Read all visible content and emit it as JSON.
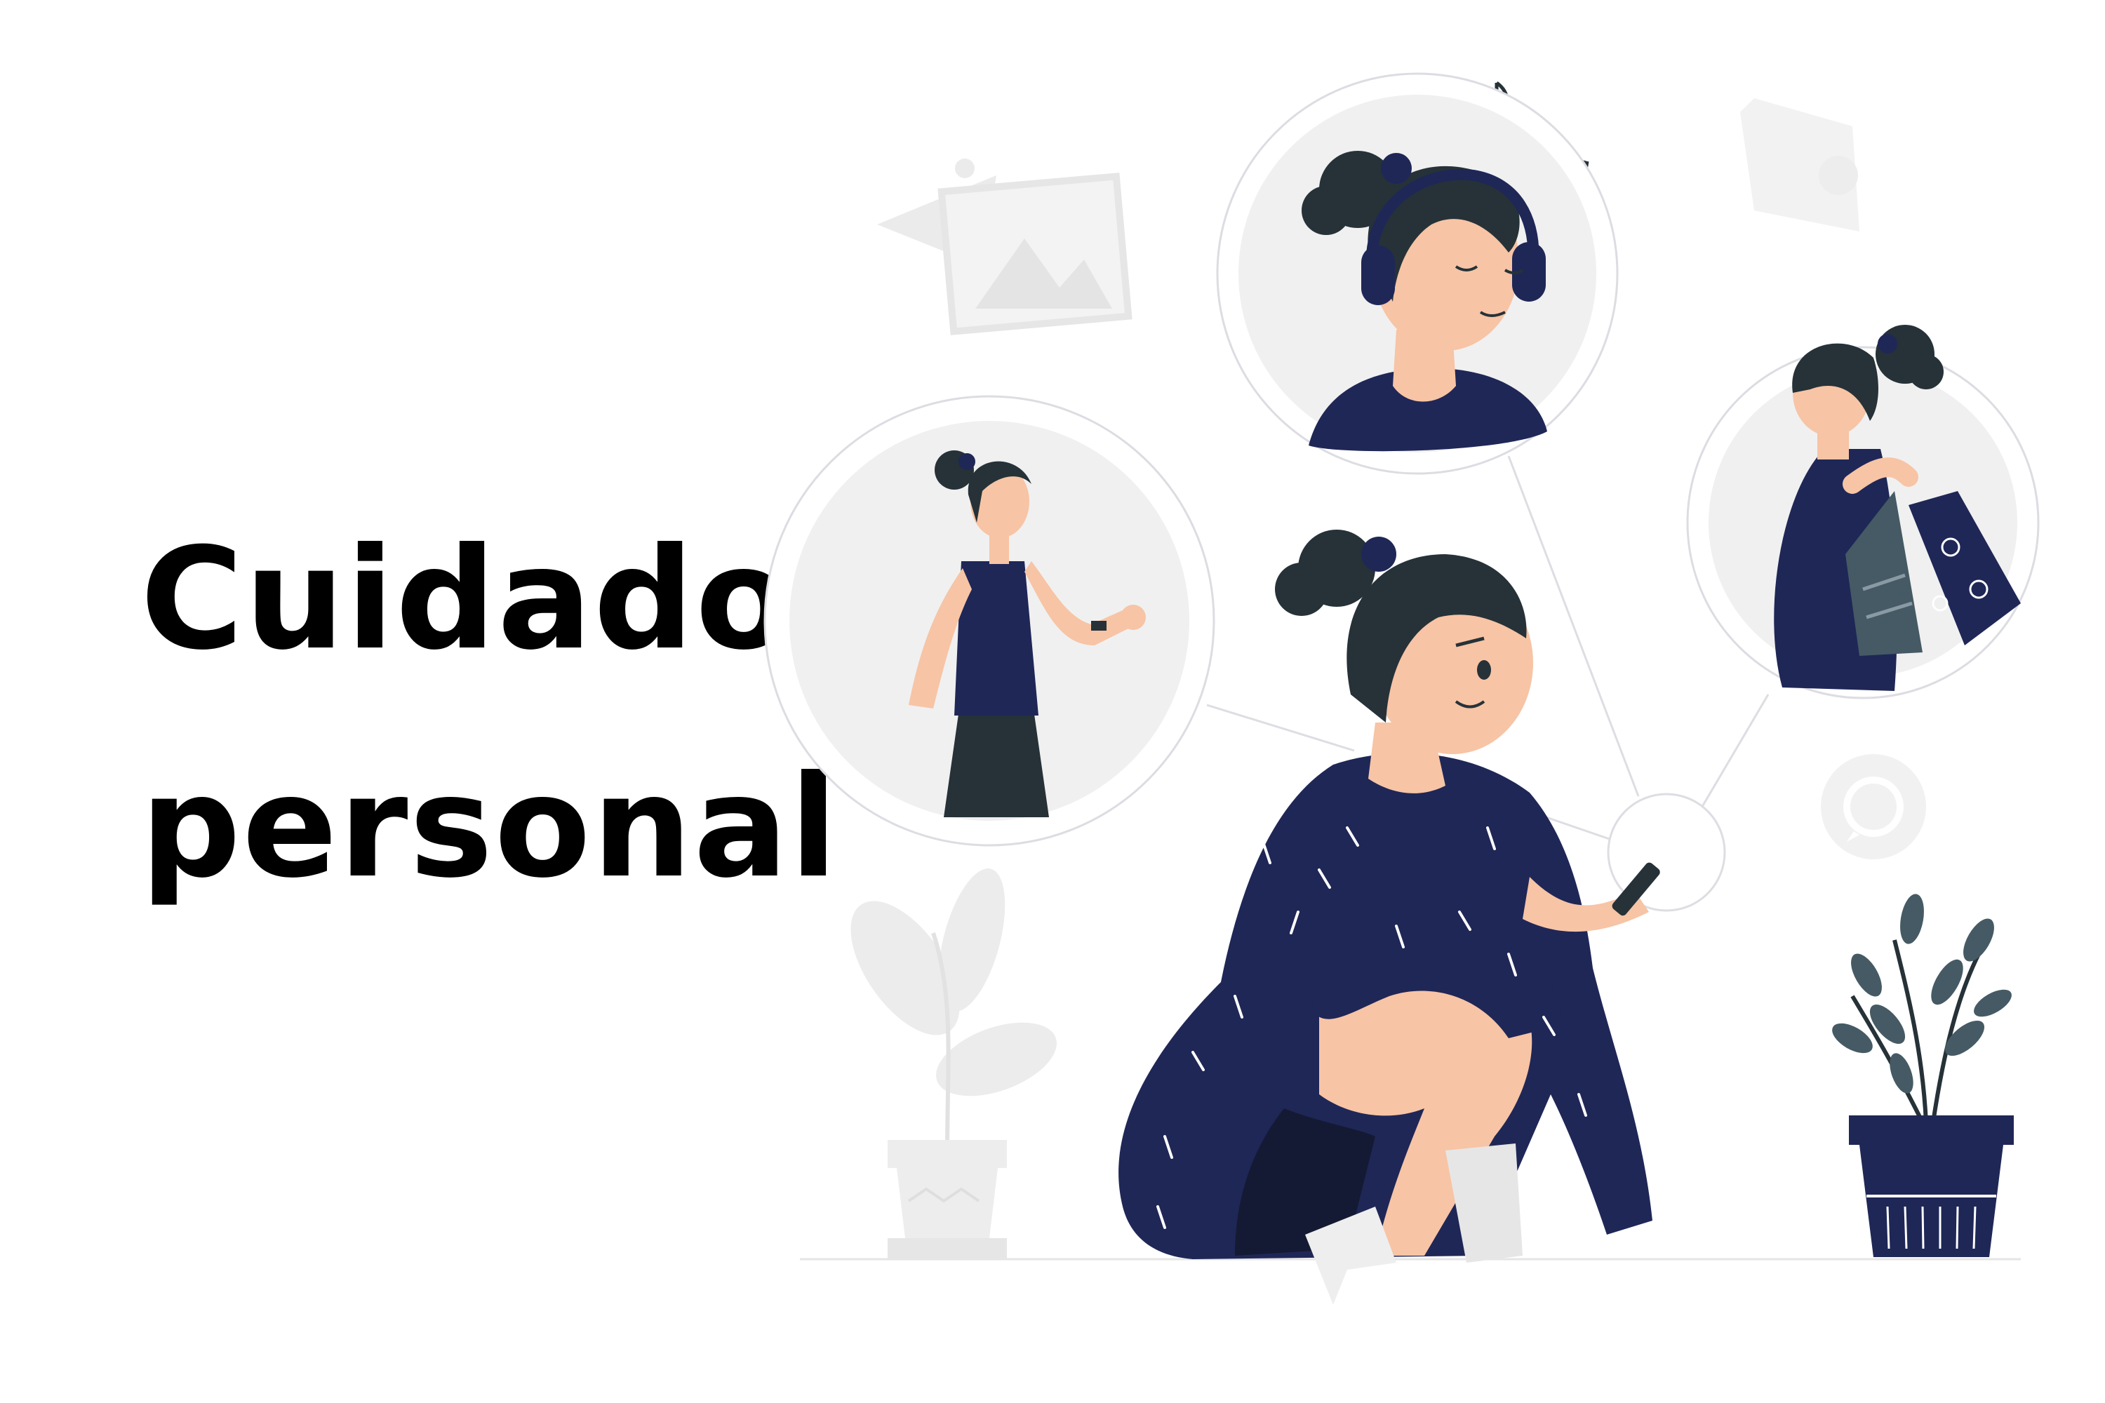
{
  "title": {
    "line1": "Cuidado",
    "line2": "personal"
  },
  "illustration": {
    "subject": "woman-sitting-with-phone",
    "bubbles": [
      "running-activity",
      "listening-to-music",
      "shopping"
    ],
    "background_icons": [
      "image-icon",
      "notification-icon",
      "whatsapp-icon",
      "plant-icon",
      "music-note-icon"
    ],
    "colors": {
      "navy": "#1f2757",
      "skin": "#f7c4a5",
      "hair": "#263238",
      "bubble_fill": "#f0f0f0",
      "bubble_stroke": "#d8d8dc",
      "ghost": "#ebebeb",
      "text": "#000000"
    }
  }
}
